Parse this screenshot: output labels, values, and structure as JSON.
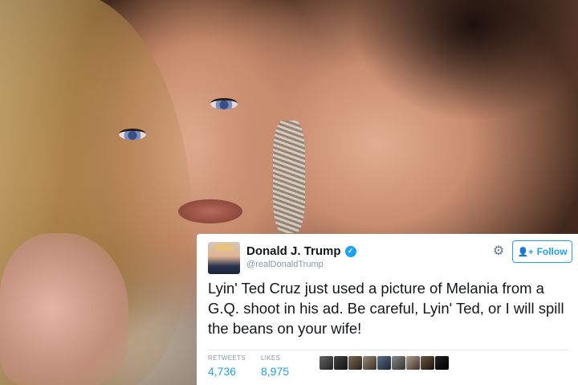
{
  "tweet": {
    "author_name": "Donald J. Trump",
    "author_handle": "@realDonaldTrump",
    "follow_label": "Follow",
    "text": "Lyin' Ted Cruz just used a picture of Melania from a G.Q. shoot in his ad. Be careful, Lyin' Ted, or I will spill the beans on your wife!",
    "retweets_label": "RETWEETS",
    "retweets_count": "4,736",
    "likes_label": "LIKES",
    "likes_count": "8,975",
    "liker_avatars_count": 9
  },
  "icons": {
    "verified": "verified-badge-icon",
    "settings": "gear-icon",
    "follow": "add-user-icon"
  },
  "colors": {
    "accent": "#1da1f2",
    "text": "#14171a",
    "muted": "#8899a6"
  }
}
